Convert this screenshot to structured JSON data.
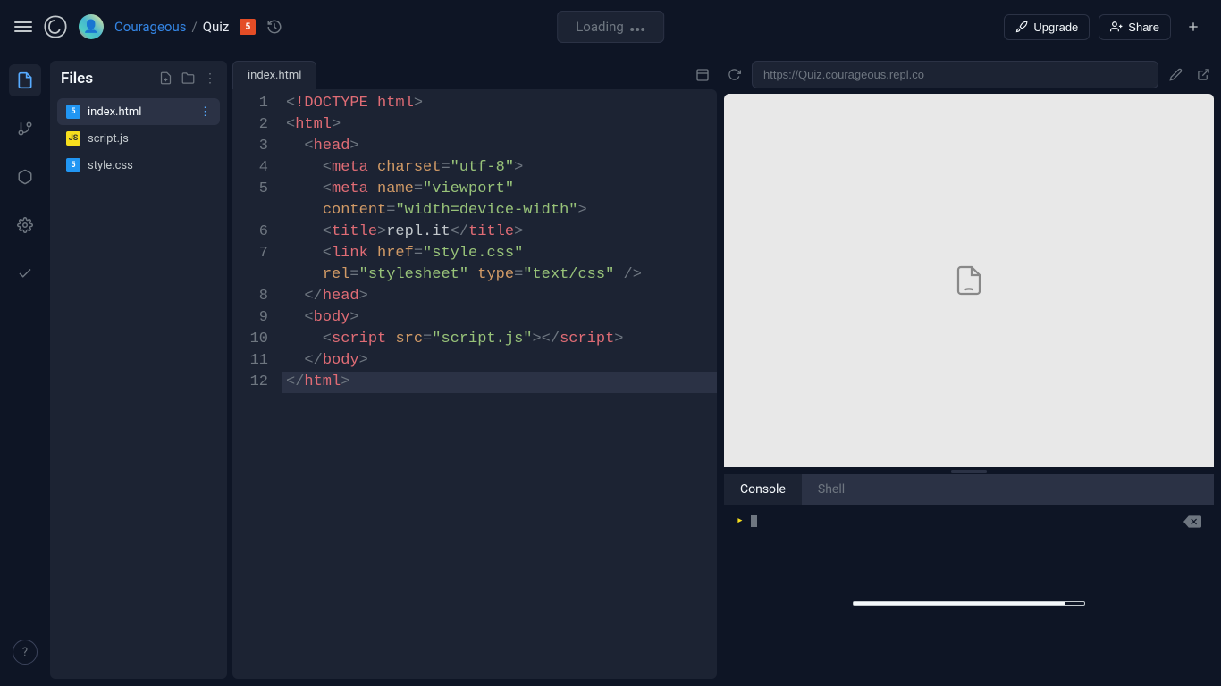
{
  "header": {
    "username": "Courageous",
    "separator": "/",
    "project": "Quiz",
    "loading_text": "Loading",
    "upgrade_label": "Upgrade",
    "share_label": "Share"
  },
  "files_panel": {
    "title": "Files",
    "items": [
      {
        "name": "index.html",
        "type": "html",
        "active": true
      },
      {
        "name": "script.js",
        "type": "js",
        "active": false
      },
      {
        "name": "style.css",
        "type": "css",
        "active": false
      }
    ]
  },
  "editor": {
    "tab_name": "index.html",
    "active_line": 12,
    "code_lines": [
      {
        "n": 1,
        "segments": [
          "<",
          "!DOCTYPE ",
          "html",
          ">"
        ],
        "classes": [
          "t-punc",
          "t-doctype",
          "t-tag",
          "t-punc"
        ]
      },
      {
        "n": 2,
        "segments": [
          "<",
          "html",
          ">"
        ],
        "classes": [
          "t-punc",
          "t-tag",
          "t-punc"
        ]
      },
      {
        "n": 3,
        "segments": [
          "  <",
          "head",
          ">"
        ],
        "classes": [
          "t-punc",
          "t-tag",
          "t-punc"
        ]
      },
      {
        "n": 4,
        "segments": [
          "    <",
          "meta",
          " ",
          "charset",
          "=",
          "\"utf-8\"",
          ">"
        ],
        "classes": [
          "t-punc",
          "t-tag",
          "",
          "t-attr",
          "t-punc",
          "t-str",
          "t-punc"
        ]
      },
      {
        "n": 5,
        "segments": [
          "    <",
          "meta",
          " ",
          "name",
          "=",
          "\"viewport\"",
          " "
        ],
        "classes": [
          "t-punc",
          "t-tag",
          "",
          "t-attr",
          "t-punc",
          "t-str",
          ""
        ]
      },
      {
        "n": null,
        "segments": [
          "    ",
          "content",
          "=",
          "\"width=device-width\"",
          ">"
        ],
        "classes": [
          "",
          "t-attr",
          "t-punc",
          "t-str",
          "t-punc"
        ]
      },
      {
        "n": 6,
        "segments": [
          "    <",
          "title",
          ">",
          "repl.it",
          "</",
          "title",
          ">"
        ],
        "classes": [
          "t-punc",
          "t-tag",
          "t-punc",
          "",
          "t-punc",
          "t-tag",
          "t-punc"
        ]
      },
      {
        "n": 7,
        "segments": [
          "    <",
          "link",
          " ",
          "href",
          "=",
          "\"style.css\"",
          " "
        ],
        "classes": [
          "t-punc",
          "t-tag",
          "",
          "t-attr",
          "t-punc",
          "t-str",
          ""
        ]
      },
      {
        "n": null,
        "segments": [
          "    ",
          "rel",
          "=",
          "\"stylesheet\"",
          " ",
          "type",
          "=",
          "\"text/css\"",
          " />"
        ],
        "classes": [
          "",
          "t-attr",
          "t-punc",
          "t-str",
          "",
          "t-attr",
          "t-punc",
          "t-str",
          "t-punc"
        ]
      },
      {
        "n": 8,
        "segments": [
          "  </",
          "head",
          ">"
        ],
        "classes": [
          "t-punc",
          "t-tag",
          "t-punc"
        ]
      },
      {
        "n": 9,
        "segments": [
          "  <",
          "body",
          ">"
        ],
        "classes": [
          "t-punc",
          "t-tag",
          "t-punc"
        ]
      },
      {
        "n": 10,
        "segments": [
          "    <",
          "script",
          " ",
          "src",
          "=",
          "\"script.js\"",
          "></",
          "script",
          ">"
        ],
        "classes": [
          "t-punc",
          "t-tag",
          "",
          "t-attr",
          "t-punc",
          "t-str",
          "t-punc",
          "t-tag",
          "t-punc"
        ]
      },
      {
        "n": 11,
        "segments": [
          "  </",
          "body",
          ">"
        ],
        "classes": [
          "t-punc",
          "t-tag",
          "t-punc"
        ]
      },
      {
        "n": 12,
        "segments": [
          "</",
          "html",
          ">"
        ],
        "classes": [
          "t-punc",
          "t-tag",
          "t-punc"
        ],
        "hl": true
      }
    ]
  },
  "preview": {
    "url": "https://Quiz.courageous.repl.co",
    "console_tab": "Console",
    "shell_tab": "Shell",
    "prompt_icon": "›"
  },
  "icons": {
    "files": "files-icon",
    "vcs": "vcs-icon",
    "packages": "packages-icon",
    "settings": "settings-icon",
    "check": "check-icon",
    "help": "?"
  }
}
